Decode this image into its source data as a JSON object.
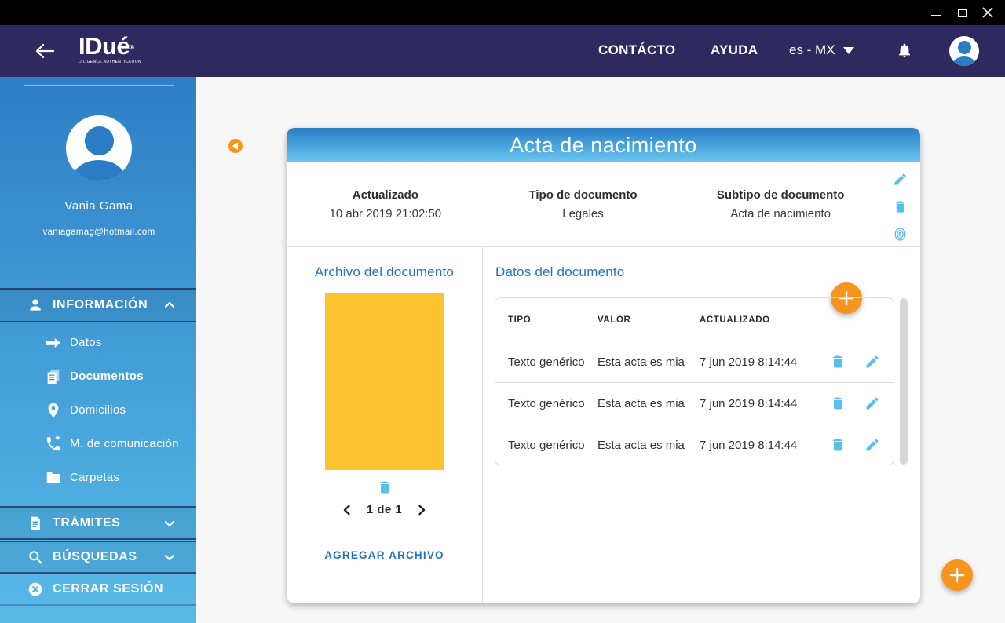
{
  "header": {
    "logo_text": "IDué",
    "logo_reg": "®",
    "logo_subtitle": "DILIGENCE AUTHENTICATION",
    "nav_contact": "CONTÁCTO",
    "nav_help": "AYUDA",
    "language_selector": "es - MX"
  },
  "sidebar": {
    "profile": {
      "name": "Vania Gama",
      "email": "vaniagamag@hotmail.com"
    },
    "sections": {
      "informacion": "INFORMACIÓN",
      "tramites": "TRÁMITES",
      "busquedas": "BÚSQUEDAS",
      "cerrar_sesion": "CERRAR SESIÓN"
    },
    "info_items": [
      {
        "label": "Datos"
      },
      {
        "label": "Documentos"
      },
      {
        "label": "Domicilios"
      },
      {
        "label": "M. de comunicación"
      },
      {
        "label": "Carpetas"
      }
    ]
  },
  "document": {
    "title": "Acta de nacimiento",
    "meta": [
      {
        "label": "Actualizado",
        "value": "10 abr 2019 21:02:50"
      },
      {
        "label": "Tipo de documento",
        "value": "Legales"
      },
      {
        "label": "Subtipo de documento",
        "value": "Acta de nacimiento"
      }
    ],
    "file_section": {
      "title": "Archivo del documento",
      "pagination": "1 de 1",
      "add_file_label": "AGREGAR ARCHIVO"
    },
    "data_section": {
      "title": "Datos del documento",
      "table": {
        "headers": [
          "TIPO",
          "VALOR",
          "ACTUALIZADO"
        ],
        "rows": [
          {
            "tipo": "Texto genérico",
            "valor": "Esta acta es mia",
            "actualizado": "7 jun 2019 8:14:44"
          },
          {
            "tipo": "Texto genérico",
            "valor": "Esta acta es mia",
            "actualizado": "7 jun 2019 8:14:44"
          },
          {
            "tipo": "Texto genérico",
            "valor": "Esta acta es mia",
            "actualizado": "7 jun 2019 8:14:44"
          }
        ]
      }
    }
  }
}
